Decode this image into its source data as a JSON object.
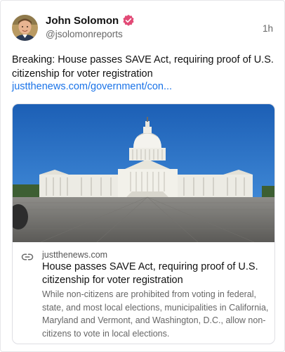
{
  "post": {
    "author_name": "John Solomon",
    "author_handle": "@jsolomonreports",
    "timestamp": "1h",
    "text": "Breaking: House passes SAVE Act, requiring proof of U.S. citizenship for voter registration",
    "link_text": "justthenews.com/government/con..."
  },
  "card": {
    "domain": "justthenews.com",
    "title": "House passes SAVE Act, requiring proof of U.S. citizenship for voter registration",
    "description": "While non-citizens are prohibited from voting in federal, state, and most local elections, municipalities in California, Maryland and Vermont, and Washington, D.C., allow non-citizens to vote in local elections."
  },
  "icons": {
    "verified": "verified-badge-icon",
    "link": "link-icon"
  },
  "colors": {
    "verified_badge": "#e24a76",
    "link": "#1a73e8",
    "secondary_text": "#666666"
  }
}
